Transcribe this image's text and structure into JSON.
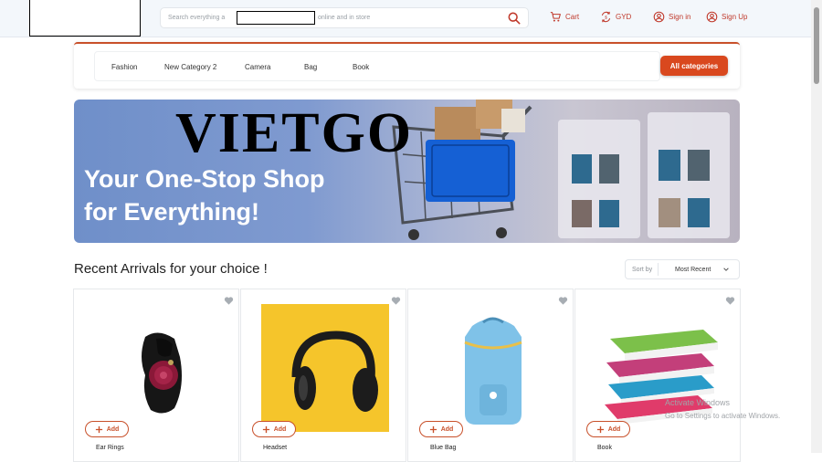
{
  "header": {
    "search_placeholder_start": "Search everything a",
    "search_placeholder_end": "online and in store",
    "cart": "Cart",
    "currency": "GYD",
    "sign_in": "Sign in",
    "sign_up": "Sign Up"
  },
  "categories": {
    "items": [
      "Fashion",
      "New Category 2",
      "Camera",
      "Bag",
      "Book"
    ],
    "all_button": "All categories"
  },
  "banner": {
    "brand": "VIETGO",
    "tagline_line1": "Your One-Stop Shop",
    "tagline_line2": "for Everything!"
  },
  "section": {
    "title": "Recent Arrivals for your choice !",
    "sort_label": "Sort by",
    "sort_value": "Most Recent"
  },
  "products": [
    {
      "name": "Ear Rings",
      "add_label": "Add"
    },
    {
      "name": "Headset",
      "add_label": "Add"
    },
    {
      "name": "Blue Bag",
      "add_label": "Add"
    },
    {
      "name": "Book",
      "add_label": "Add"
    }
  ],
  "watermark": {
    "line1": "Activate Windows",
    "line2": "Go to Settings to activate Windows."
  },
  "colors": {
    "accent": "#d9481e",
    "header_bg": "#f3f7fb"
  }
}
